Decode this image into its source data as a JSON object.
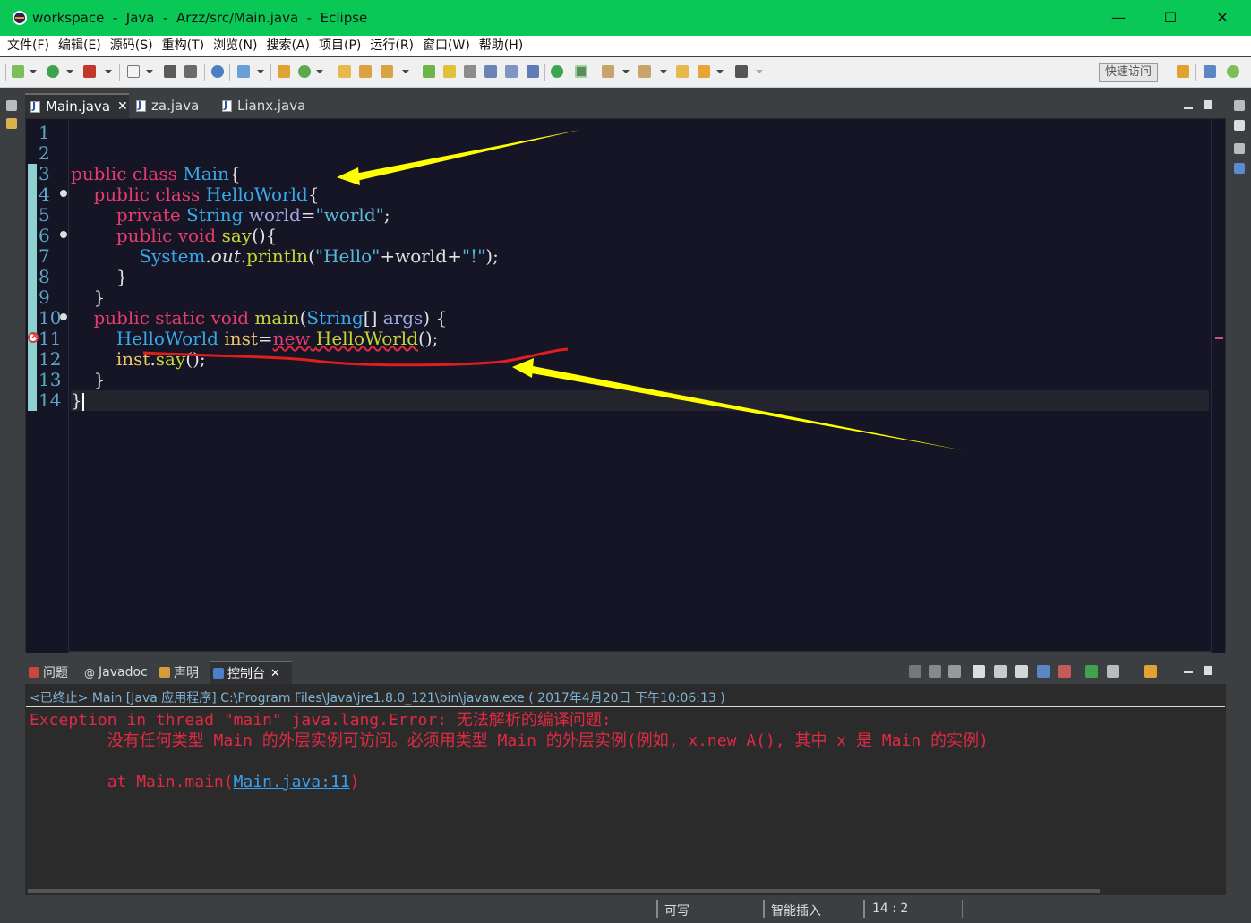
{
  "window": {
    "title": "workspace  -  Java  -  Arzz/src/Main.java  -  Eclipse",
    "minimize": "—",
    "maximize": "☐",
    "close": "✕"
  },
  "menu": [
    "文件(F)",
    "编辑(E)",
    "源码(S)",
    "重构(T)",
    "浏览(N)",
    "搜索(A)",
    "项目(P)",
    "运行(R)",
    "窗口(W)",
    "帮助(H)"
  ],
  "toolbar": {
    "quick_access": "快速访问"
  },
  "editor_tabs": [
    {
      "label": "Main.java",
      "close": "✕"
    },
    {
      "label": "za.java"
    },
    {
      "label": "Lianx.java"
    }
  ],
  "editor": {
    "line_numbers": [
      "1",
      "2",
      "3",
      "4",
      "5",
      "6",
      "7",
      "8",
      "9",
      "10",
      "11",
      "12",
      "13",
      "14"
    ],
    "lines": {
      "l3": {
        "a": "public class ",
        "b": "Main",
        "c": "{"
      },
      "l4": {
        "indent": "    ",
        "a": "public class ",
        "b": "HelloWorld",
        "c": "{"
      },
      "l5": {
        "indent": "        ",
        "a": "private ",
        "b": "String ",
        "c": "world",
        "d": "=",
        "e": "\"world\"",
        "f": ";"
      },
      "l6": {
        "indent": "        ",
        "a": "public void ",
        "b": "say",
        "c": "(){"
      },
      "l7": {
        "indent": "            ",
        "a": "System",
        "b": ".",
        "c": "out",
        "d": ".",
        "e": "println",
        "f": "(",
        "g": "\"Hello\"",
        "h": "+world+",
        "i": "\"!\"",
        "j": ");"
      },
      "l8": {
        "indent": "        ",
        "a": "}"
      },
      "l9": {
        "indent": "    ",
        "a": "}"
      },
      "l10": {
        "indent": "    ",
        "a": "public static void ",
        "b": "main",
        "c": "(",
        "d": "String",
        "e": "[] ",
        "f": "args",
        "g": ") {"
      },
      "l11": {
        "indent": "        ",
        "a": "HelloWorld",
        "b": " inst",
        "c": "=",
        "d": "new",
        "e": " ",
        "f": "HelloWorld",
        "g": "();"
      },
      "l12": {
        "indent": "        ",
        "a": "inst",
        "b": ".",
        "c": "say",
        "d": "();"
      },
      "l13": {
        "indent": "    ",
        "a": "}"
      },
      "l14": {
        "a": "}"
      }
    }
  },
  "bottom_tabs": [
    {
      "label": "问题"
    },
    {
      "label": "Javadoc"
    },
    {
      "label": "声明"
    },
    {
      "label": "控制台",
      "close": "✕"
    }
  ],
  "console": {
    "header": "<已终止> Main [Java 应用程序] C:\\Program Files\\Java\\jre1.8.0_121\\bin\\javaw.exe ( 2017年4月20日 下午10:06:13 )",
    "line1": "Exception in thread \"main\" java.lang.Error: 无法解析的编译问题:",
    "line2": "\t没有任何类型 Main 的外层实例可访问。必须用类型 Main 的外层实例(例如, x.new A(), 其中 x 是 Main 的实例)",
    "line3_prefix": "\tat Main.main(",
    "line3_link": "Main.java:11",
    "line3_suffix": ")"
  },
  "status": {
    "writable": "可写",
    "insert_mode": "智能插入",
    "position": "14 : 2"
  },
  "colors": {
    "titlebar": "#0ac856",
    "editor_bg": "#151526",
    "keyword": "#e53c6f",
    "type": "#38a9e8",
    "method": "#c7d536",
    "error": "#e02a42",
    "annotation_arrow": "#ffff00",
    "annotation_underline": "#e11d1d"
  }
}
